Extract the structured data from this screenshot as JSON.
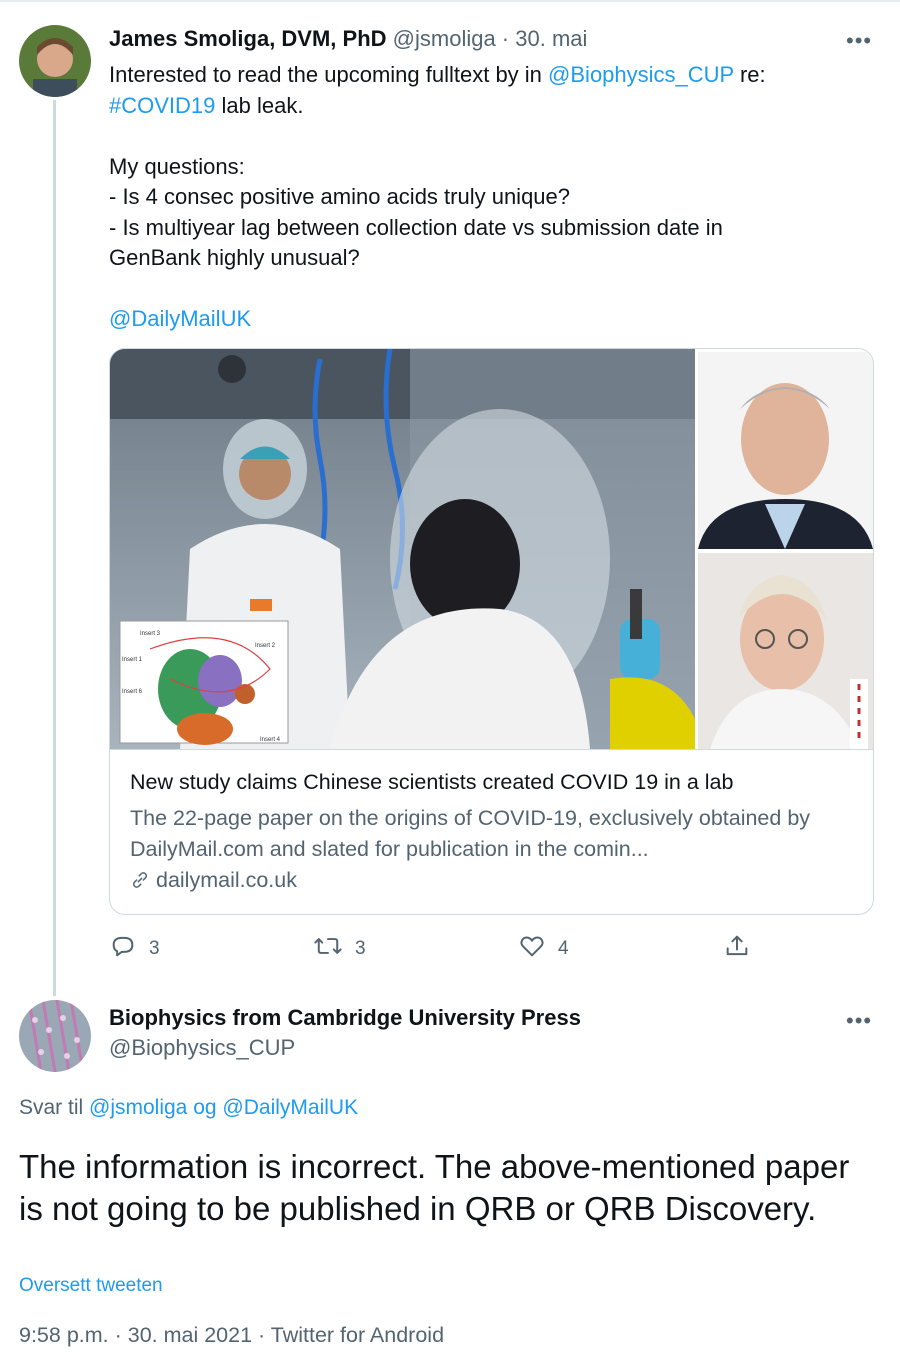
{
  "tweet1": {
    "author_name": "James Smoliga, DVM, PhD",
    "handle": "@jsmoliga",
    "separator": " · ",
    "date": "30. mai",
    "more": "•••",
    "text_line1_pre": "Interested to read the upcoming fulltext by in ",
    "text_line1_mention": "@Biophysics_CUP",
    "text_line1_post": " re:",
    "text_line2_hashtag": "#COVID19",
    "text_line2_post": " lab leak.",
    "questions_header": "My questions:",
    "question1": "- Is 4 consec positive amino acids truly unique?",
    "question2": "- Is multiyear lag between collection date vs submission date in GenBank highly unusual?",
    "mention2": "@DailyMailUK",
    "card": {
      "title": "New study claims Chinese scientists created COVID 19 in a lab",
      "description": "The 22-page paper on the origins of COVID-19, exclusively obtained by DailyMail.com and slated for publication in the comin...",
      "domain": "dailymail.co.uk",
      "inset_labels": [
        "Insert 3",
        "Insert 2",
        "Insert 1",
        "Insert 6",
        "Insert 4"
      ]
    },
    "actions": {
      "reply_count": "3",
      "retweet_count": "3",
      "like_count": "4"
    }
  },
  "tweet2": {
    "author_name": "Biophysics from Cambridge University Press",
    "handle": "@Biophysics_CUP",
    "more": "•••",
    "reply_prefix": "Svar til ",
    "reply_mention1": "@jsmoliga",
    "reply_join": " og ",
    "reply_mention2": "@DailyMailUK",
    "text": "The information is incorrect. The above-mentioned paper is not going to be published in QRB or QRB Discovery.",
    "translate": "Oversett tweeten",
    "meta": "9:58 p.m. · 30. mai 2021 · Twitter for Android"
  },
  "colors": {
    "link": "#1d9bf0",
    "muted": "#536471",
    "text": "#0f1419",
    "border": "#cfd9de"
  },
  "icons": [
    "reply-icon",
    "retweet-icon",
    "like-icon",
    "share-icon",
    "link-icon"
  ]
}
